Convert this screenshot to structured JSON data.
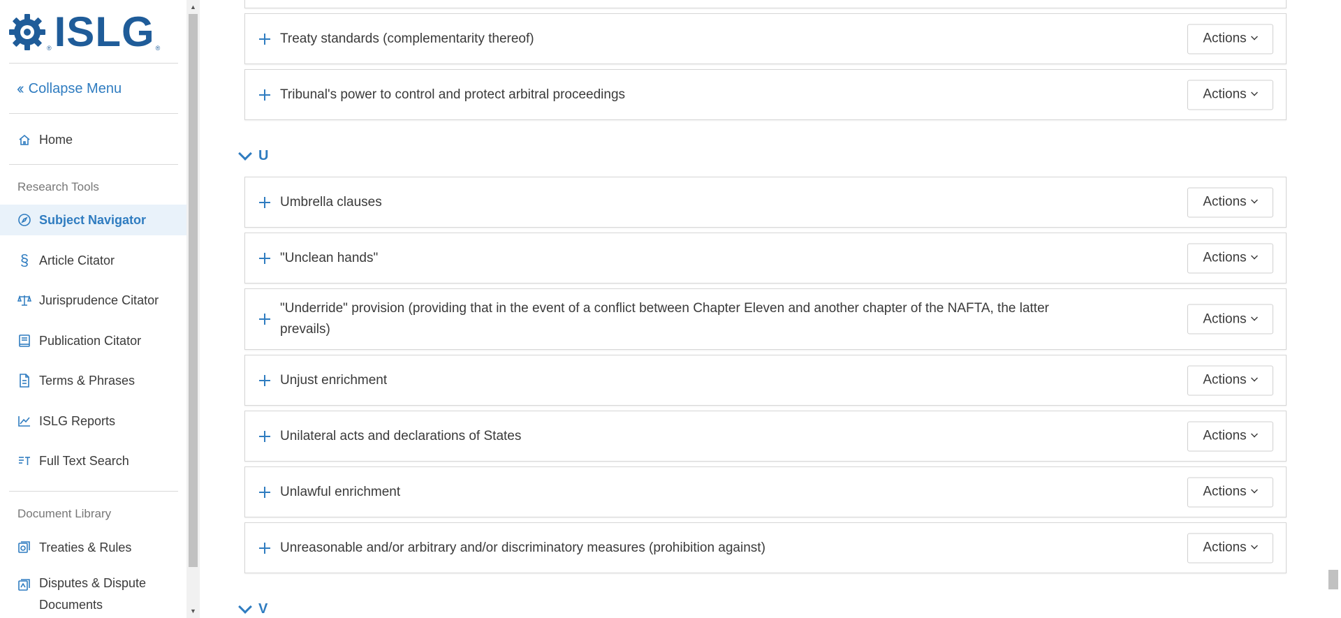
{
  "brand": {
    "logo_text": "ISLG",
    "logo_mark": "®"
  },
  "sidebar": {
    "collapse_label": "Collapse Menu",
    "home_label": "Home",
    "research_tools_label": "Research Tools",
    "research_items": [
      {
        "label": "Subject Navigator",
        "icon": "compass-icon",
        "active": true
      },
      {
        "label": "Article Citator",
        "icon": "section-icon"
      },
      {
        "label": "Jurisprudence Citator",
        "icon": "scales-icon"
      },
      {
        "label": "Publication Citator",
        "icon": "book-icon"
      },
      {
        "label": "Terms & Phrases",
        "icon": "document-icon"
      },
      {
        "label": "ISLG Reports",
        "icon": "chart-icon"
      },
      {
        "label": "Full Text Search",
        "icon": "text-search-icon"
      }
    ],
    "document_library_label": "Document Library",
    "library_items": [
      {
        "label": "Treaties & Rules",
        "icon": "treaty-icon"
      },
      {
        "label": "Disputes & Dispute Documents",
        "icon": "dispute-icon"
      }
    ]
  },
  "main": {
    "actions_label": "Actions",
    "items_t": [
      "Treaty standards (complementarity thereof)",
      "Tribunal's power to control and protect arbitral proceedings"
    ],
    "letter_u": "U",
    "items_u": [
      "Umbrella clauses",
      "\"Unclean hands\"",
      "\"Underride\" provision (providing that in the event of a conflict between Chapter Eleven and another chapter of the NAFTA, the latter prevails)",
      "Unjust enrichment",
      "Unilateral acts and declarations of States",
      "Unlawful enrichment",
      "Unreasonable and/or arbitrary and/or discriminatory measures (prohibition against)"
    ],
    "letter_v": "V"
  },
  "colors": {
    "accent": "#2f7cc0",
    "brand": "#1f5c99",
    "active_bg": "#e9f2fa"
  }
}
